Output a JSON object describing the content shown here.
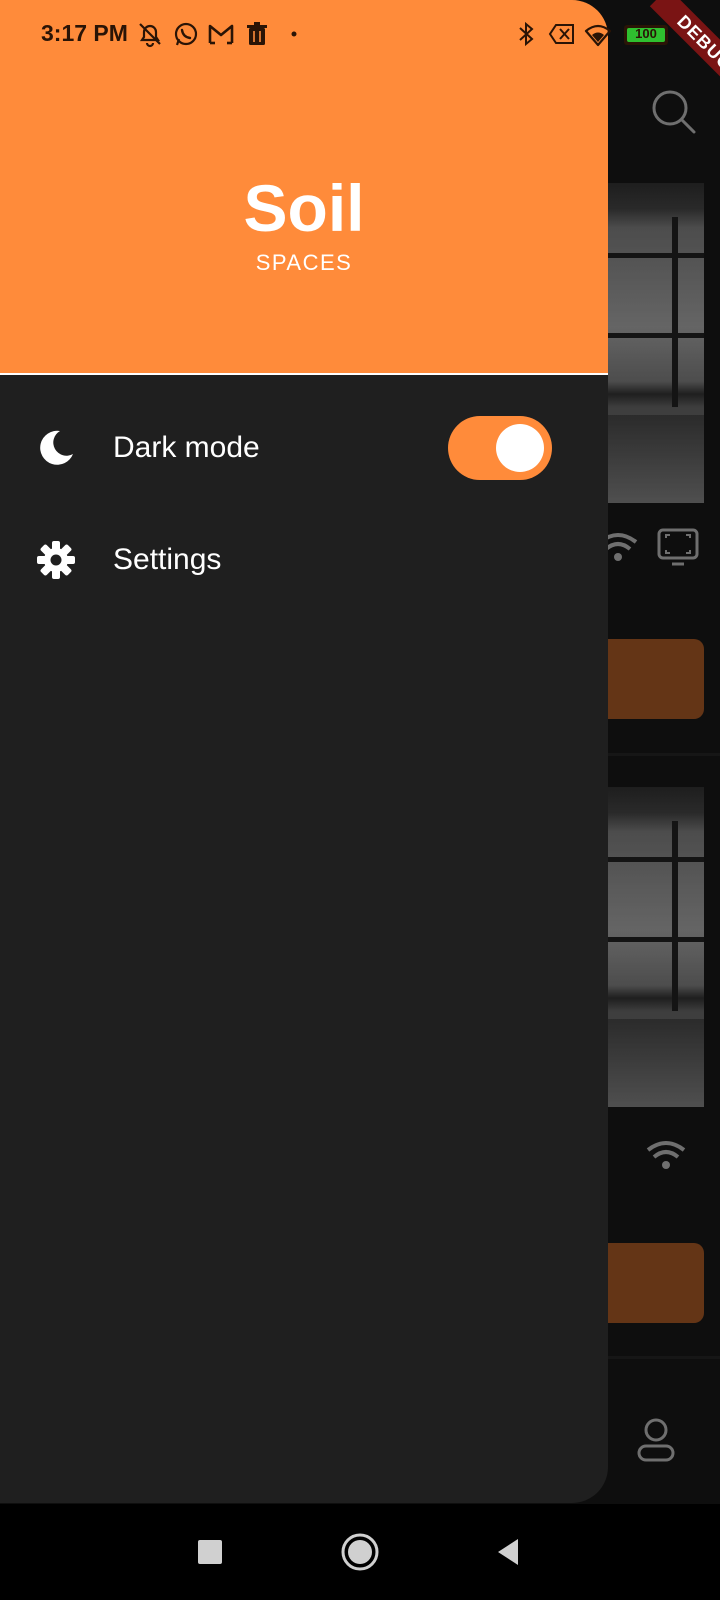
{
  "status_bar": {
    "time": "3:17 PM",
    "left_icons": [
      "bell-off-icon",
      "whatsapp-icon",
      "gmail-icon",
      "trash-icon",
      "dot-icon"
    ],
    "right_icons": [
      "bluetooth-icon",
      "no-sim-icon",
      "wifi-icon",
      "battery-icon"
    ],
    "battery": "100"
  },
  "debug_banner": "DEBUG",
  "drawer": {
    "header": {
      "title": "Soil",
      "subtitle": "SPACES",
      "background_color": "#ff8b3a"
    },
    "items": [
      {
        "icon": "moon-icon",
        "label": "Dark mode",
        "toggle_on": true
      },
      {
        "icon": "gear-icon",
        "label": "Settings"
      }
    ]
  },
  "nav_bar": {
    "buttons": [
      "recents-square-icon",
      "home-circle-icon",
      "back-triangle-icon"
    ]
  },
  "colors": {
    "accent": "#ff8b3a",
    "drawer_bg": "#1f1f1f",
    "bg_button": "#8b4a1f"
  }
}
